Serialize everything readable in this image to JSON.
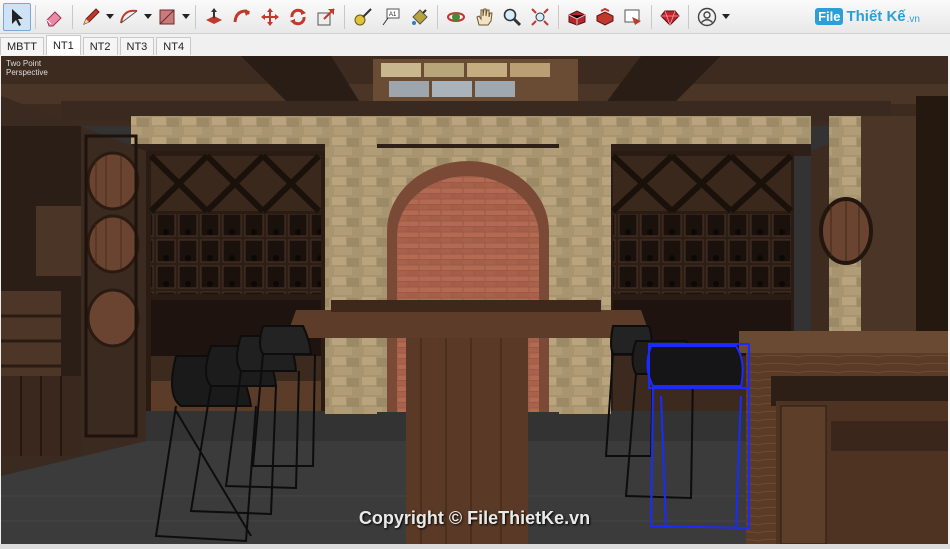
{
  "toolbar": {
    "tools": [
      {
        "name": "select-tool",
        "icon": "arrow-cursor-icon",
        "active": true
      },
      {
        "name": "eraser-tool",
        "icon": "eraser-icon"
      },
      {
        "name": "line-tool",
        "icon": "pencil-icon",
        "dropdown": true
      },
      {
        "name": "arc-tool",
        "icon": "arc-icon",
        "dropdown": true
      },
      {
        "name": "shape-tool",
        "icon": "rectangle-icon",
        "dropdown": true
      },
      {
        "name": "push-pull-tool",
        "icon": "push-pull-icon"
      },
      {
        "name": "follow-me-tool",
        "icon": "follow-me-icon"
      },
      {
        "name": "move-tool",
        "icon": "move-icon"
      },
      {
        "name": "rotate-tool",
        "icon": "rotate-icon"
      },
      {
        "name": "scale-tool",
        "icon": "scale-icon"
      },
      {
        "name": "tape-measure-tool",
        "icon": "tape-measure-icon"
      },
      {
        "name": "text-tool",
        "icon": "text-icon"
      },
      {
        "name": "paint-bucket-tool",
        "icon": "paint-bucket-icon"
      },
      {
        "name": "orbit-tool",
        "icon": "orbit-icon"
      },
      {
        "name": "pan-tool",
        "icon": "hand-icon"
      },
      {
        "name": "zoom-tool",
        "icon": "magnifier-icon"
      },
      {
        "name": "zoom-extents-tool",
        "icon": "zoom-extents-icon"
      },
      {
        "name": "warehouse-tool",
        "icon": "warehouse-icon"
      },
      {
        "name": "extension-warehouse-tool",
        "icon": "extension-icon"
      },
      {
        "name": "layout-tool",
        "icon": "layout-icon"
      },
      {
        "name": "ruby-console-tool",
        "icon": "ruby-icon"
      },
      {
        "name": "account-tool",
        "icon": "user-icon",
        "dropdown": true
      }
    ]
  },
  "brand": {
    "badge": "File",
    "name": "Thiết Kế",
    "domain": ".vn"
  },
  "tabs": [
    {
      "label": "MBTT",
      "selected": false
    },
    {
      "label": "NT1",
      "selected": true
    },
    {
      "label": "NT2",
      "selected": false
    },
    {
      "label": "NT3",
      "selected": false
    },
    {
      "label": "NT4",
      "selected": false
    }
  ],
  "viewport": {
    "camera_label_line1": "Two Point",
    "camera_label_line2": "Perspective",
    "watermark": "Copyright © FileThietKe.vn"
  },
  "colors": {
    "accent": "#2a9fd8",
    "selection": "#1a2bff"
  }
}
